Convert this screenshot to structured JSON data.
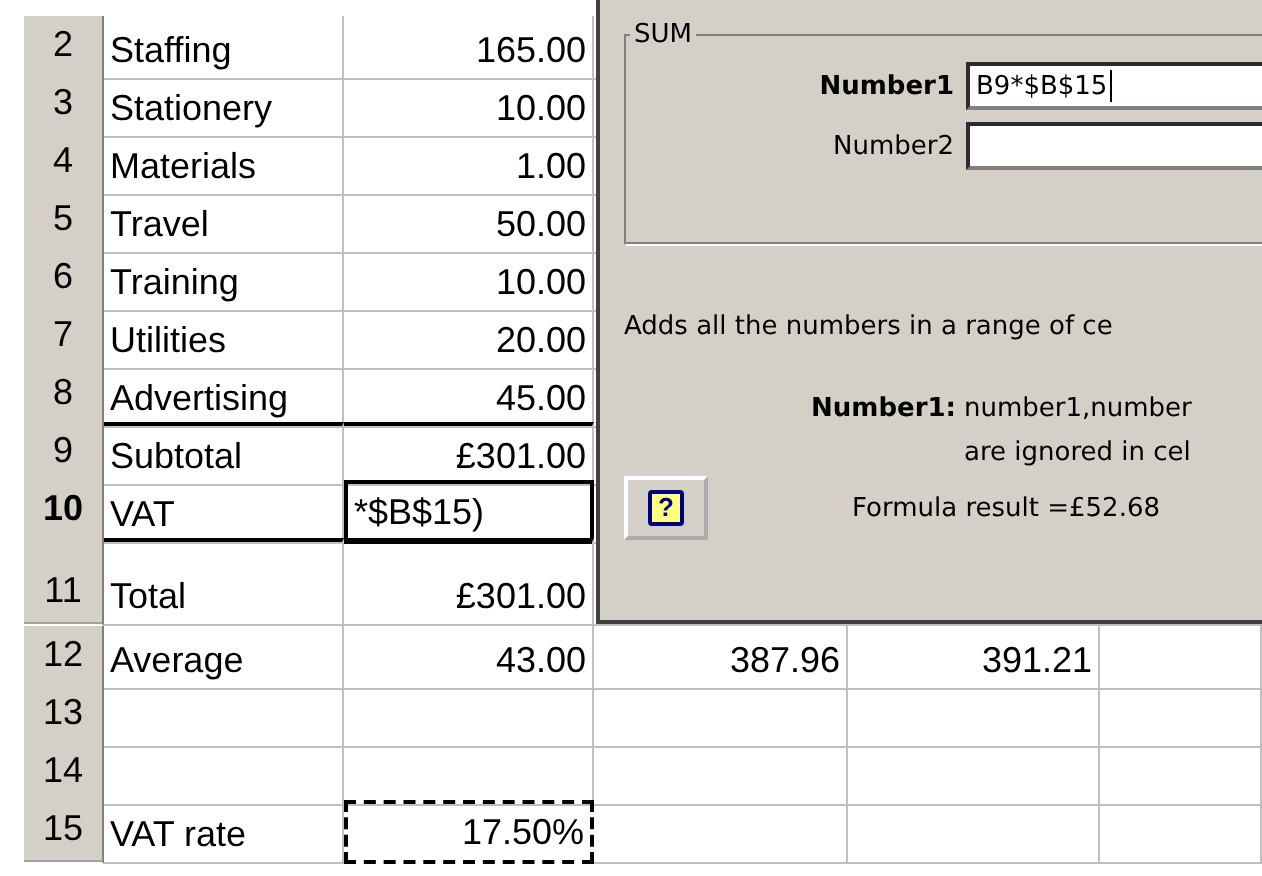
{
  "rows": [
    {
      "number": "2",
      "label": "Staffing",
      "value": {
        "text": "165.00",
        "kind": "number"
      },
      "selected": false
    },
    {
      "number": "3",
      "label": "Stationery",
      "value": {
        "text": "10.00",
        "kind": "number"
      },
      "selected": false
    },
    {
      "number": "4",
      "label": "Materials",
      "value": {
        "text": "1.00",
        "kind": "number"
      },
      "selected": false
    },
    {
      "number": "5",
      "label": "Travel",
      "value": {
        "text": "50.00",
        "kind": "number"
      },
      "selected": false
    },
    {
      "number": "6",
      "label": "Training",
      "value": {
        "text": "10.00",
        "kind": "number"
      },
      "selected": false
    },
    {
      "number": "7",
      "label": "Utilities",
      "value": {
        "text": "20.00",
        "kind": "number"
      },
      "selected": false
    },
    {
      "number": "8",
      "label": "Advertising",
      "value": {
        "text": "45.00",
        "kind": "number"
      },
      "selected": false
    },
    {
      "number": "9",
      "label": "Subtotal",
      "value": {
        "text": "£301.00",
        "kind": "number"
      },
      "selected": false,
      "rule_above": true
    },
    {
      "number": "10",
      "label": "VAT",
      "value": {
        "text": "*$B$15)",
        "kind": "editing"
      },
      "selected": true
    },
    {
      "number": "11",
      "label": "Total",
      "value": {
        "text": "£301.00",
        "kind": "number"
      },
      "selected": false,
      "rule_above": true,
      "tall": true
    },
    {
      "number": "12",
      "label": "Average",
      "value": {
        "text": "43.00",
        "kind": "number"
      },
      "selected": false,
      "column_c": "387.96",
      "column_d": "391.21"
    },
    {
      "number": "13",
      "selected": false
    },
    {
      "number": "14",
      "selected": false
    },
    {
      "number": "15",
      "label": "VAT rate",
      "value": {
        "text": "17.50%",
        "kind": "copied"
      },
      "selected": false
    }
  ],
  "dialog": {
    "group_title": "SUM",
    "fields": [
      {
        "label": "Number1",
        "value": "B9*$B$15",
        "bold": true
      },
      {
        "label": "Number2",
        "bold": false
      }
    ],
    "description": "Adds all the numbers in a range of ce",
    "argument_label": "Number1:",
    "argument_help": [
      "number1,number",
      "are ignored in cel"
    ],
    "help_button": "?",
    "result": "Formula result =£52.68"
  }
}
